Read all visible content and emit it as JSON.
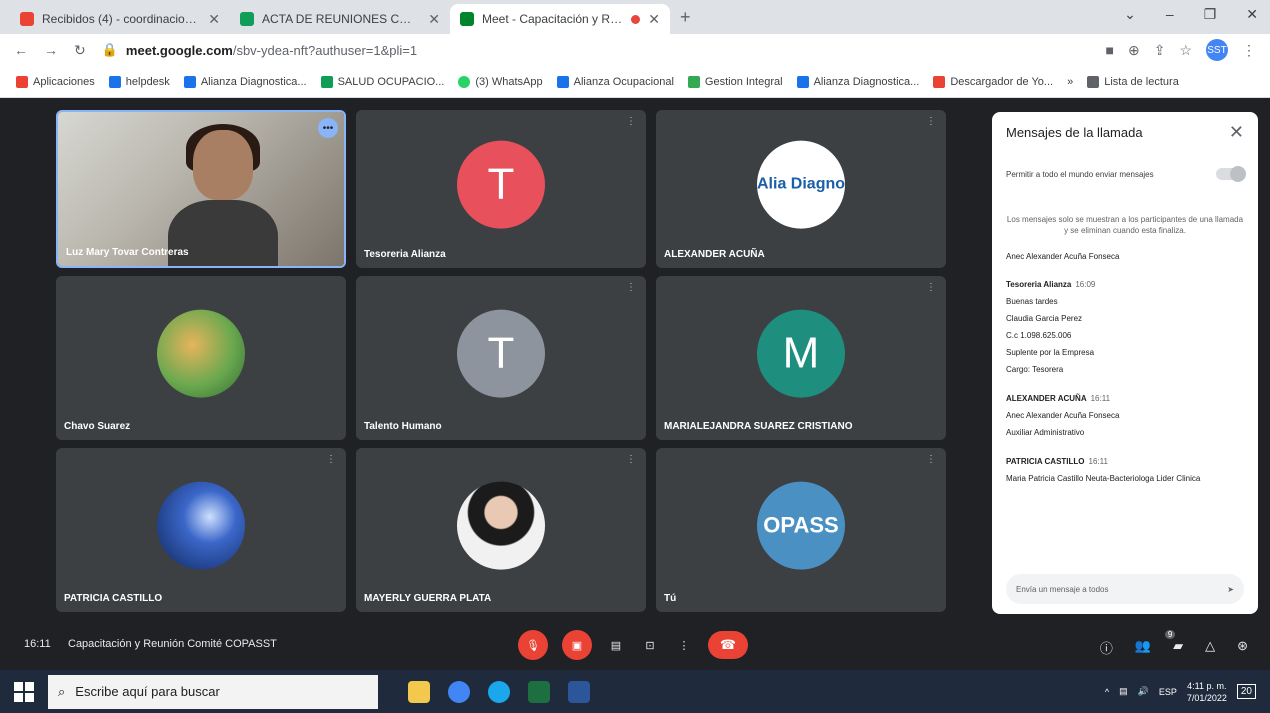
{
  "browser": {
    "tabs": [
      {
        "label": "Recibidos (4) - coordinacionsst@",
        "color": "#ea4335",
        "active": false
      },
      {
        "label": "ACTA DE REUNIONES COPASST",
        "color": "#0f9d58",
        "active": false
      },
      {
        "label": "Meet - Capacitación y Reuni",
        "color": "#00832d",
        "active": true
      }
    ],
    "new_tab": "+",
    "url_host": "meet.google.com",
    "url_path": "/sbv-ydea-nft?authuser=1&pli=1",
    "profile_initials": "SST"
  },
  "bookmarks": [
    {
      "label": "Aplicaciones",
      "color": "#ea4335"
    },
    {
      "label": "helpdesk",
      "color": "#1a73e8"
    },
    {
      "label": "Alianza Diagnostica...",
      "color": "#1a73e8"
    },
    {
      "label": "SALUD OCUPACIO...",
      "color": "#0f9d58"
    },
    {
      "label": "(3) WhatsApp",
      "color": "#25d366"
    },
    {
      "label": "Alianza Ocupacional",
      "color": "#1a73e8"
    },
    {
      "label": "Gestion Integral",
      "color": "#34a853"
    },
    {
      "label": "Alianza Diagnostica...",
      "color": "#1a73e8"
    },
    {
      "label": "Descargador de Yo...",
      "color": "#ea4335"
    },
    {
      "label": "»",
      "color": "transparent"
    },
    {
      "label": "Lista de lectura",
      "color": "#5f6368"
    }
  ],
  "participants": [
    {
      "name": "Luz Mary Tovar Contreras",
      "kind": "video"
    },
    {
      "name": "Tesoreria Alianza",
      "kind": "initial",
      "initial": "T",
      "color": "#e8505b"
    },
    {
      "name": "ALEXANDER ACUÑA",
      "kind": "logo",
      "logo_text": "Alia Diagno",
      "color": "#ffffff"
    },
    {
      "name": "Chavo Suarez",
      "kind": "photo",
      "color": "#6aa84f"
    },
    {
      "name": "Talento Humano",
      "kind": "initial",
      "initial": "T",
      "color": "#8d949e"
    },
    {
      "name": "MARIALEJANDRA SUAREZ CRISTIANO",
      "kind": "initial",
      "initial": "M",
      "color": "#1e8e7e"
    },
    {
      "name": "PATRICIA CASTILLO",
      "kind": "photo",
      "color": "#1a3f8f"
    },
    {
      "name": "MAYERLY GUERRA PLATA",
      "kind": "photo",
      "color": "#f1f1f1"
    },
    {
      "name": "Tú",
      "kind": "logo",
      "logo_text": "OPASS",
      "color": "#4a90c2"
    }
  ],
  "chat": {
    "title": "Mensajes de la llamada",
    "toggle_label": "Permitir a todo el mundo enviar mensajes",
    "info": "Los mensajes solo se muestran a los participantes de una llamada y se eliminan cuando esta finaliza.",
    "pinned": "Anec Alexander Acuña Fonseca",
    "messages": [
      {
        "sender": "Tesoreria Alianza",
        "time": "16:09",
        "lines": [
          "Buenas tardes",
          "Claudia Garcia Perez",
          "C.c 1.098.625.006",
          "Suplente por la Empresa",
          "Cargo: Tesorera"
        ]
      },
      {
        "sender": "ALEXANDER ACUÑA",
        "time": "16:11",
        "lines": [
          "Anec Alexander Acuña Fonseca",
          "Auxiliar Administrativo"
        ]
      },
      {
        "sender": "PATRICIA CASTILLO",
        "time": "16:11",
        "lines": [
          "Maria Patricia Castillo Neuta-Bacteriologa Lider Clinica"
        ]
      }
    ],
    "input_placeholder": "Envía un mensaje a todos"
  },
  "meeting": {
    "time": "16:11",
    "title": "Capacitación y Reunión Comité COPASST",
    "people_count": "9"
  },
  "taskbar": {
    "search_placeholder": "Escribe aquí para buscar",
    "lang": "ESP",
    "time": "4:11 p. m.",
    "date": "7/01/2022",
    "notifications": "20"
  }
}
